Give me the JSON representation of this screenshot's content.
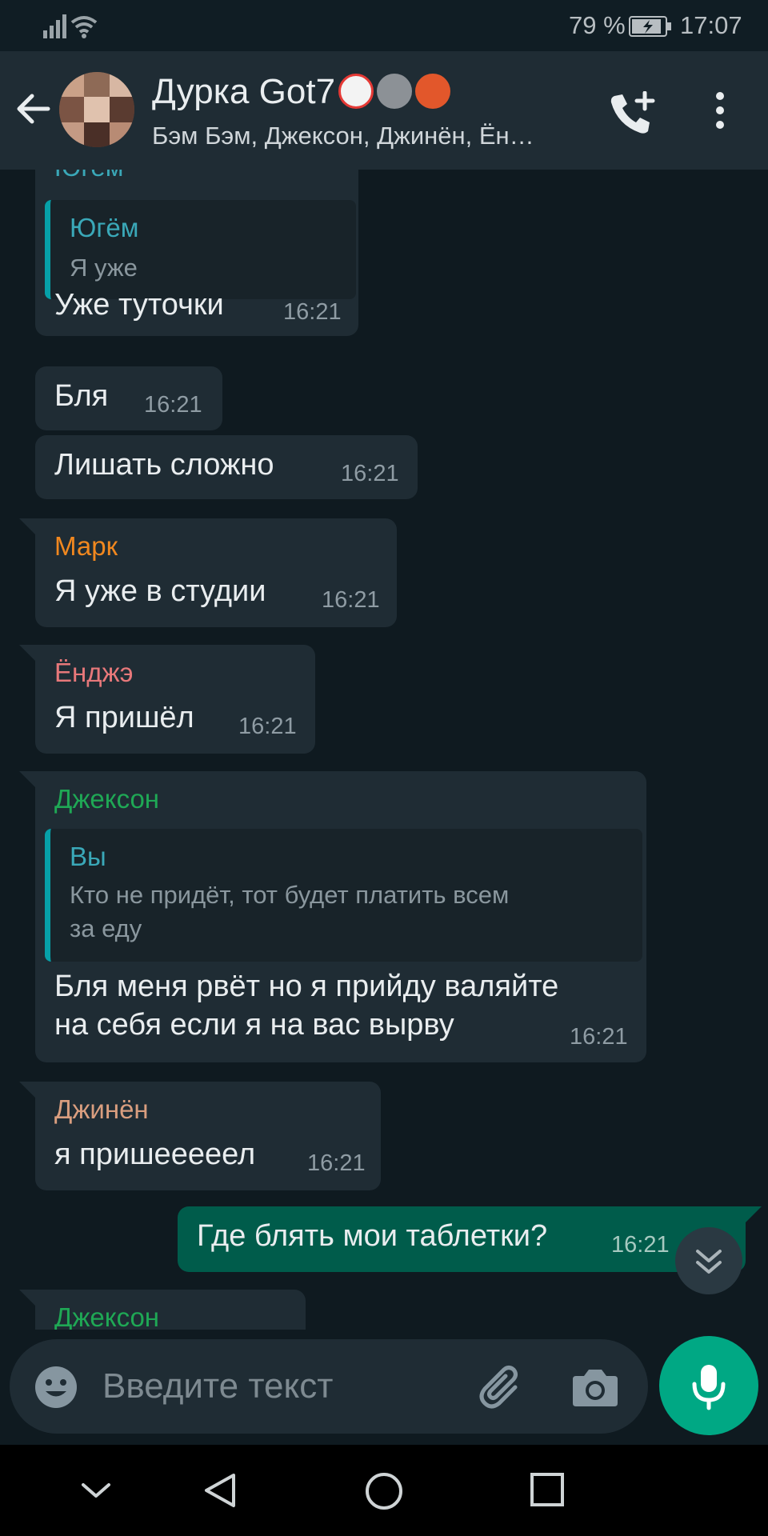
{
  "status": {
    "battery_percent": "79 %",
    "time": "17:07"
  },
  "header": {
    "title": "Дурка Got7",
    "members": "Бэм Бэм, Джексон, Джинён, Ён…"
  },
  "messages": [
    {
      "sender": "Югём",
      "quote_sender": "Югём",
      "quote_text": "Я уже",
      "text": "Уже туточки",
      "time": "16:21"
    },
    {
      "text": "Бля",
      "time": "16:21"
    },
    {
      "text": "Лишать сложно",
      "time": "16:21"
    },
    {
      "sender": "Марк",
      "text": "Я уже в студии",
      "time": "16:21"
    },
    {
      "sender": "Ёнджэ",
      "text": "Я пришёл",
      "time": "16:21"
    },
    {
      "sender": "Джексон",
      "quote_sender": "Вы",
      "quote_text_1": "Кто не придёт, тот будет платить всем",
      "quote_text_2": "за еду",
      "text_1": "Бля меня рвёт но я прийду валяйте",
      "text_2": "на себя если я на вас вырву",
      "time": "16:21"
    },
    {
      "sender": "Джинён",
      "text": "я пришееееел",
      "time": "16:21"
    },
    {
      "outgoing": true,
      "text": "Где блять мои таблетки?",
      "time": "16:21"
    },
    {
      "sender": "Джексон"
    }
  ],
  "sender_colors": {
    "Югём": "#3aa8b8",
    "Марк": "#f1881f",
    "Ёнджэ": "#e7787a",
    "Джексон": "#1fa855",
    "Джинён": "#d99e7f"
  },
  "input": {
    "placeholder": "Введите текст"
  },
  "icons": {
    "back": "arrow-left-icon",
    "call_add": "phone-plus-icon",
    "menu": "more-vertical-icon",
    "emoji": "smiley-icon",
    "attach": "paperclip-icon",
    "camera": "camera-icon",
    "mic": "microphone-icon",
    "scroll": "double-chevron-down-icon"
  },
  "colors": {
    "accent": "#00a884",
    "outgoing_bubble": "#005c4b",
    "incoming_bubble": "#1f2c34",
    "background": "#0f1a20"
  }
}
